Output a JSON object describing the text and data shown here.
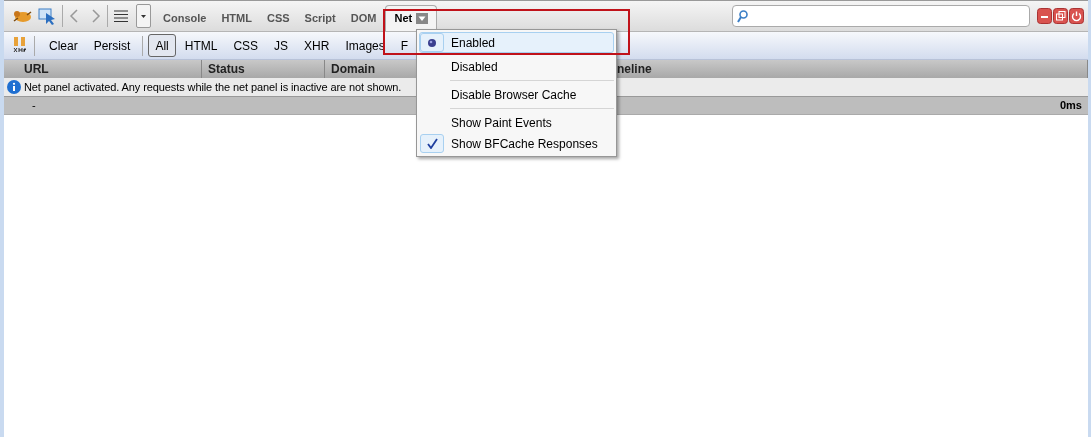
{
  "toolbar": {
    "tabs": [
      {
        "label": "Console",
        "selected": false
      },
      {
        "label": "HTML",
        "selected": false
      },
      {
        "label": "CSS",
        "selected": false
      },
      {
        "label": "Script",
        "selected": false
      },
      {
        "label": "DOM",
        "selected": false
      },
      {
        "label": "Net",
        "selected": true
      }
    ]
  },
  "filters": [
    {
      "label": "Clear",
      "kind": "action",
      "selected": false
    },
    {
      "label": "Persist",
      "kind": "action",
      "selected": false
    },
    {
      "label": "All",
      "kind": "filter",
      "selected": true
    },
    {
      "label": "HTML",
      "kind": "filter",
      "selected": false
    },
    {
      "label": "CSS",
      "kind": "filter",
      "selected": false
    },
    {
      "label": "JS",
      "kind": "filter",
      "selected": false
    },
    {
      "label": "XHR",
      "kind": "filter",
      "selected": false
    },
    {
      "label": "Images",
      "kind": "filter",
      "selected": false
    },
    {
      "label": "F",
      "kind": "filter",
      "selected": false
    }
  ],
  "table": {
    "columns": [
      "URL",
      "Status",
      "Domain",
      "neline"
    ],
    "info": "Net panel activated. Any requests while the net panel is inactive are not shown.",
    "summary": {
      "count": "-",
      "time": "0ms"
    }
  },
  "menu": {
    "items": [
      {
        "label": "Enabled",
        "kind": "radio",
        "checked": true,
        "highlighted": true
      },
      {
        "label": "Disabled",
        "kind": "radio",
        "checked": false,
        "highlighted": false
      },
      {
        "kind": "separator"
      },
      {
        "label": "Disable Browser Cache",
        "kind": "check",
        "checked": false,
        "highlighted": false
      },
      {
        "kind": "separator"
      },
      {
        "label": "Show Paint Events",
        "kind": "check",
        "checked": false,
        "highlighted": false
      },
      {
        "label": "Show BFCache Responses",
        "kind": "check",
        "checked": true,
        "highlighted": false
      }
    ]
  }
}
